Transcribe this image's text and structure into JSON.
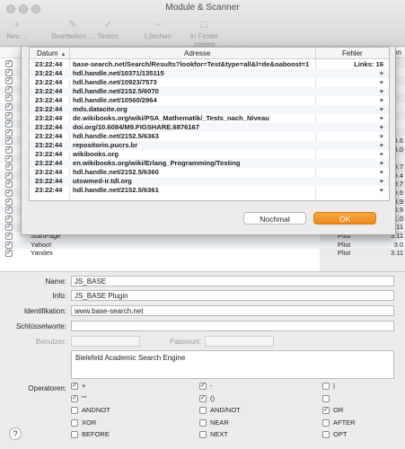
{
  "window": {
    "title": "Module & Scanner"
  },
  "toolbar": {
    "items": [
      {
        "label": "Neu ..."
      },
      {
        "label": "Bearbeiten ..."
      },
      {
        "label": "Testen"
      },
      {
        "label": "Löschen"
      },
      {
        "label": "In Finder zeigen"
      }
    ]
  },
  "background_list": {
    "header_version": "sion",
    "rows": [
      {
        "name": "",
        "type": "",
        "version": ""
      },
      {
        "name": "",
        "type": "",
        "version": ""
      },
      {
        "name": "",
        "type": "",
        "version": ""
      },
      {
        "name": "",
        "type": "",
        "version": ""
      },
      {
        "name": "",
        "type": "",
        "version": ""
      },
      {
        "name": "",
        "type": "",
        "version": ""
      },
      {
        "name": "",
        "type": "",
        "version": ""
      },
      {
        "name": "",
        "type": "",
        "version": ""
      },
      {
        "name": "",
        "type": "",
        "version": ""
      },
      {
        "name": "",
        "type": "",
        "version": "3.6"
      },
      {
        "name": "",
        "type": "",
        "version": "3.0"
      },
      {
        "name": "",
        "type": "",
        "version": ""
      },
      {
        "name": "",
        "type": "",
        "version": "3.9.7"
      },
      {
        "name": "",
        "type": "",
        "version": "3.9.4"
      },
      {
        "name": "",
        "type": "",
        "version": "3.9.7"
      },
      {
        "name": "",
        "type": "",
        "version": "3.9.6"
      },
      {
        "name": "",
        "type": "",
        "version": "3.9"
      },
      {
        "name": "",
        "type": "",
        "version": "3.9"
      },
      {
        "name": "",
        "type": "",
        "version": "1.0"
      },
      {
        "name": "Qwant",
        "type": "Plist",
        "version": "3.11"
      },
      {
        "name": "StartPage",
        "type": "Plist",
        "version": "3.11"
      },
      {
        "name": "Yahoo!",
        "type": "Plist",
        "version": "3.0"
      },
      {
        "name": "Yandex",
        "type": "Plist",
        "version": "3.11"
      }
    ]
  },
  "sheet": {
    "columns": {
      "time": "Datum",
      "address": "Adresse",
      "error": "Fehler"
    },
    "rows": [
      {
        "time": "23:22:44",
        "address": "base-search.net/Search/Results?lookfor=Test&type=all&l=de&oaboost=1",
        "error": "Links: 16"
      },
      {
        "time": "23:22:44",
        "address": "hdl.handle.net/10371/135115",
        "error": "+"
      },
      {
        "time": "23:22:44",
        "address": "hdl.handle.net/10923/7573",
        "error": "+"
      },
      {
        "time": "23:22:44",
        "address": "hdl.handle.net/2152.5/6070",
        "error": "+"
      },
      {
        "time": "23:22:44",
        "address": "hdl.handle.net/10560/2964",
        "error": "+"
      },
      {
        "time": "23:22:44",
        "address": "mds.datacite.org",
        "error": "+"
      },
      {
        "time": "23:22:44",
        "address": "de.wikibooks.org/wiki/PSA_Mathematik/_Tests_nach_Niveau",
        "error": "+"
      },
      {
        "time": "23:22:44",
        "address": "doi.org/10.6084/M9.FIGSHARE.6876167",
        "error": "+"
      },
      {
        "time": "23:22:44",
        "address": "hdl.handle.net/2152.5/6363",
        "error": "+"
      },
      {
        "time": "23:22:44",
        "address": "repositorio.pucrs.br",
        "error": "+"
      },
      {
        "time": "23:22:44",
        "address": "wikibooks.org",
        "error": "+"
      },
      {
        "time": "23:22:44",
        "address": "en.wikibooks.org/wiki/Erlang_Programming/Testing",
        "error": "+"
      },
      {
        "time": "23:22:44",
        "address": "hdl.handle.net/2152.5/6360",
        "error": "+"
      },
      {
        "time": "23:22:44",
        "address": "utswmed-ir.tdl.org",
        "error": "+"
      },
      {
        "time": "23:22:44",
        "address": "hdl.handle.net/2152.5/6361",
        "error": "+"
      }
    ],
    "buttons": {
      "again": "Nochmal",
      "ok": "OK"
    }
  },
  "form": {
    "name_label": "Name:",
    "name_value": "JS_BASE",
    "info_label": "Info:",
    "info_value": "JS_BASE Plugin",
    "ident_label": "Identifikation:",
    "ident_value": "www.base-search.net",
    "keywords_label": "Schlüsselworte:",
    "keywords_value": "",
    "user_label": "Benutzer:",
    "password_label": "Passwort:",
    "description": "Bielefeld Academic Search Engine",
    "operators_label": "Operatoren:",
    "operators": [
      {
        "label": "+",
        "checked": true
      },
      {
        "label": "-",
        "checked": true
      },
      {
        "label": "|",
        "checked": false
      },
      {
        "label": "\"\"",
        "checked": true
      },
      {
        "label": "()",
        "checked": true
      },
      {
        "label": "",
        "checked": false
      },
      {
        "label": "ANDNOT",
        "checked": false
      },
      {
        "label": "AND/NOT",
        "checked": false
      },
      {
        "label": "OR",
        "checked": true
      },
      {
        "label": "XOR",
        "checked": false
      },
      {
        "label": "NEAR",
        "checked": false
      },
      {
        "label": "AFTER",
        "checked": false
      },
      {
        "label": "BEFORE",
        "checked": false
      },
      {
        "label": "NEXT",
        "checked": false
      },
      {
        "label": "OPT",
        "checked": false
      }
    ],
    "help_label": "?"
  }
}
